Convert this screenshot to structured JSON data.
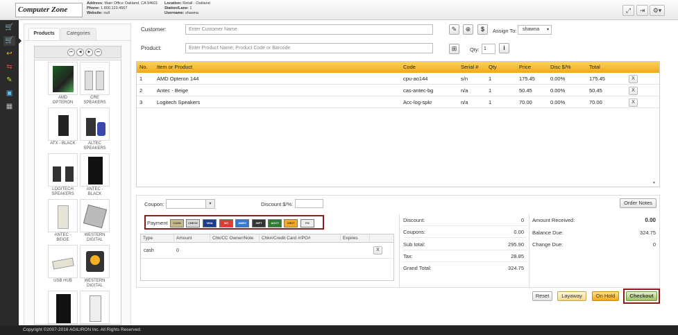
{
  "header": {
    "logo": "Computer Zone",
    "address_label": "Address:",
    "address": "Main Office Oakland, CA 94601",
    "phone_label": "Phone:",
    "phone": "1.800.123.4567",
    "website_label": "Website:",
    "website": "null",
    "location_label": "Location:",
    "location": "Retail - Oakland",
    "station_label": "Station/Lane:",
    "station": "1",
    "username_label": "Username:",
    "username": "shawna"
  },
  "left": {
    "tabs": [
      "Products",
      "Categories"
    ],
    "products": [
      {
        "name": "AMD OPTERON"
      },
      {
        "name": "CRE SPEAKERS"
      },
      {
        "name": "ATX - BLACK"
      },
      {
        "name": "ALTEC SPEAKERS"
      },
      {
        "name": "LOGITECH SPEAKERS"
      },
      {
        "name": "ANTEC - BLACK"
      },
      {
        "name": "ANTEC - BEIGE"
      },
      {
        "name": "WESTERN DIGITAL"
      },
      {
        "name": "USB HUB"
      },
      {
        "name": "WESTERN DIGITAL"
      },
      {
        "name": ""
      },
      {
        "name": ""
      }
    ]
  },
  "form": {
    "customer_label": "Customer:",
    "customer_placeholder": "Enter Customer Name",
    "product_label": "Product:",
    "product_placeholder": "Enter Product Name, Product Code or Barcode",
    "assign_label": "Assign To:",
    "assign_value": "shawna",
    "qty_label": "Qty:",
    "qty_value": "1"
  },
  "table": {
    "headers": [
      "No.",
      "Item or Product",
      "Code",
      "Serial #",
      "Qty",
      "Price",
      "Disc $/%",
      "Total"
    ],
    "rows": [
      {
        "no": "1",
        "item": "AMD Opteron 144",
        "code": "cpu-ao144",
        "serial": "s/n",
        "qty": "1",
        "price": "175.45",
        "disc": "0.00%",
        "total": "175.45"
      },
      {
        "no": "2",
        "item": "Antec - Beige",
        "code": "cas-antec-bg",
        "serial": "n/a",
        "qty": "1",
        "price": "50.45",
        "disc": "0.00%",
        "total": "50.45"
      },
      {
        "no": "3",
        "item": "Logitech Speakers",
        "code": "Acc-log-spkr",
        "serial": "n/a",
        "qty": "1",
        "price": "70.00",
        "disc": "0.00%",
        "total": "70.00"
      }
    ],
    "remove_label": "X"
  },
  "bottom": {
    "coupon_label": "Coupon:",
    "discount_label": "Discount $/%:",
    "order_notes": "Order Notes",
    "payment_label": "Payment",
    "cards": [
      "CASH",
      "CHECK",
      "VISA",
      "MC",
      "AMEX",
      "GIFT",
      "ACCT",
      "CRDT",
      "PG"
    ],
    "pay_headers": [
      "Type",
      "Amount",
      "Chk/CC Owner/Note",
      "Chk#/Credit Card #/PO#",
      "Expires"
    ],
    "pay_row": {
      "type": "cash",
      "amount": "0",
      "remove": "X"
    },
    "summary": [
      {
        "label": "Discount:",
        "value": "0"
      },
      {
        "label": "Coupons:",
        "value": "0.00"
      },
      {
        "label": "Sub total:",
        "value": "295.90"
      },
      {
        "label": "Tax:",
        "value": "28.85"
      },
      {
        "label": "Grand Total:",
        "value": "324.75"
      }
    ],
    "received_label": "Amount Received:",
    "received": "0.00",
    "balance_label": "Balance Due:",
    "balance": "324.75",
    "change_label": "Change Due:",
    "change": "0"
  },
  "actions": {
    "reset": "Reset",
    "layaway": "Layaway",
    "onhold": "On Hold",
    "checkout": "Checkout"
  },
  "footer": "Copyright ©2007-2016 AGILIRON Inc. All Rights Reserved.",
  "colors": {
    "accent": "#f5b323",
    "sidebar": "#2a2a2a",
    "checkout_border": "#8b1a1a"
  }
}
